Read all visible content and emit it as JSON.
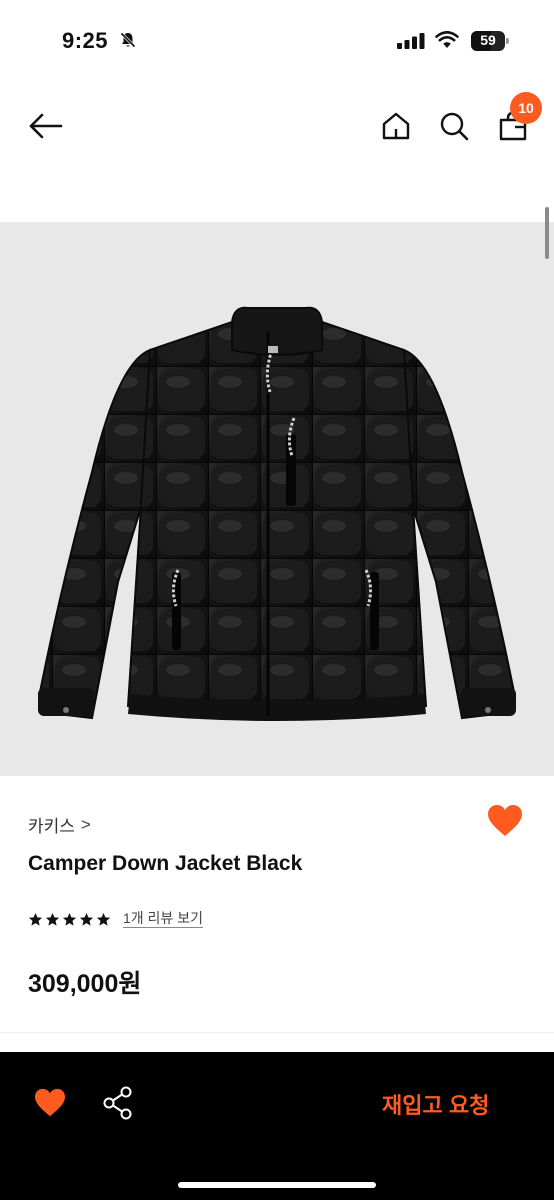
{
  "status_bar": {
    "time": "9:25",
    "battery": "59",
    "battery_fraction": 0.59
  },
  "nav": {
    "cart_count": "10",
    "icons": [
      "back-arrow-icon",
      "home-icon",
      "search-icon",
      "shopping-bag-icon"
    ]
  },
  "product": {
    "brand": "카키스",
    "brand_chevron": ">",
    "name": "Camper Down Jacket Black",
    "rating_stars": 5,
    "review_link": "1개 리뷰 보기",
    "price": "309,000원",
    "image_subject": "black quilted down jacket"
  },
  "bottom_bar": {
    "restock_label": "재입고 요청"
  },
  "colors": {
    "accent": "#ff5a1f",
    "image_bg": "#e8e8e8",
    "bottom_bar_bg": "#000000"
  }
}
